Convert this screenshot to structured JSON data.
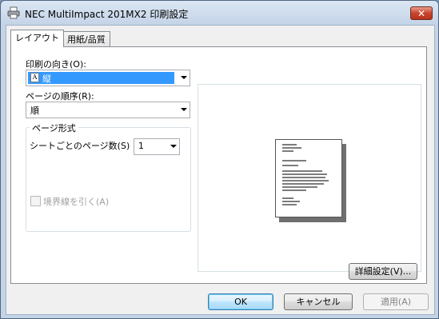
{
  "window": {
    "title": "NEC MultiImpact 201MX2 印刷設定",
    "icon": "printer-icon",
    "close_label": "✕"
  },
  "tabs": [
    {
      "label": "レイアウト",
      "active": true
    },
    {
      "label": "用紙/品質",
      "active": false
    }
  ],
  "layout": {
    "orientation": {
      "label": "印刷の向き(O):",
      "value": "縦",
      "icon": "portrait-orientation-icon"
    },
    "page_order": {
      "label": "ページの順序(R):",
      "value": "順"
    },
    "page_format": {
      "title": "ページ形式",
      "pages_per_sheet_label": "シートごとのページ数(S)",
      "pages_per_sheet_value": "1",
      "draw_borders_label": "境界線を引く(A)",
      "draw_borders_checked": false
    },
    "advanced_button": "詳細設定(V)..."
  },
  "buttons": {
    "ok": "OK",
    "cancel": "キャンセル",
    "apply": "適用(A)"
  }
}
